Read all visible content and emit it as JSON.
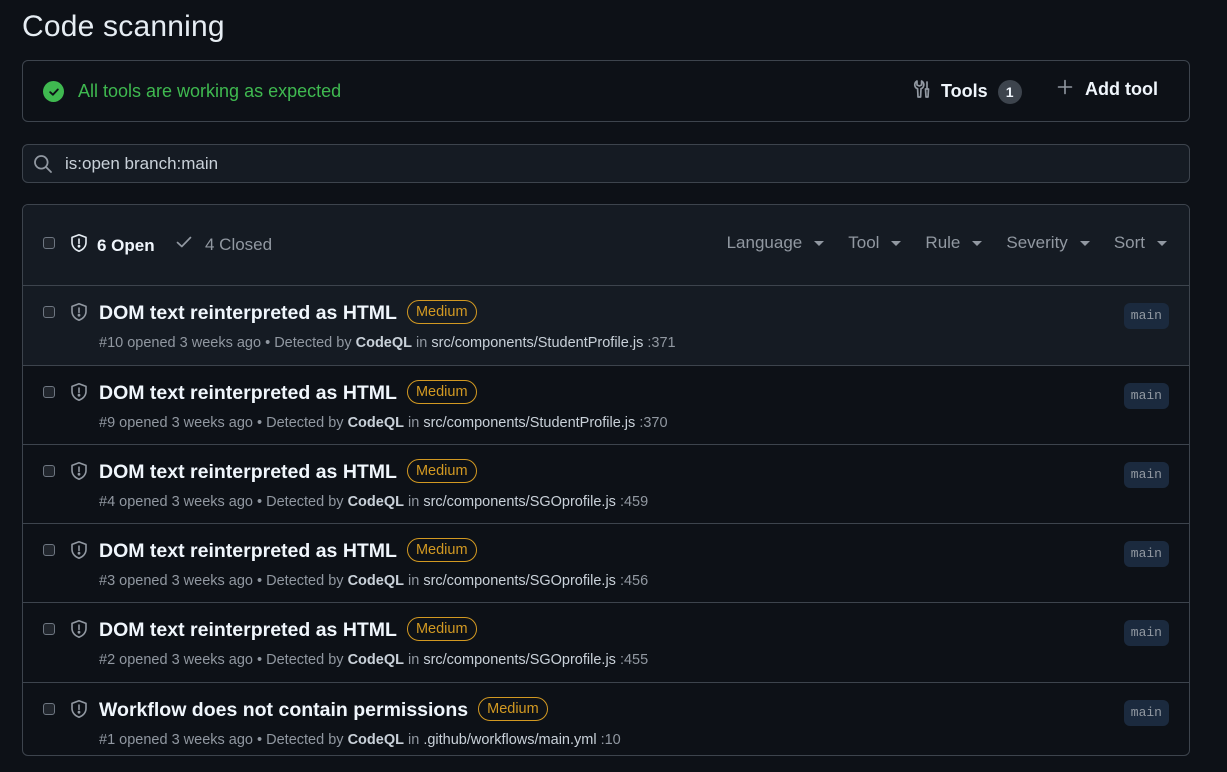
{
  "page": {
    "title": "Code scanning"
  },
  "status": {
    "message": "All tools are working as expected",
    "tools_label": "Tools",
    "tools_count": "1",
    "add_tool_label": "Add tool"
  },
  "search": {
    "value": "is:open branch:main",
    "placeholder": ""
  },
  "header": {
    "open_label": "6 Open",
    "closed_label": "4 Closed",
    "filters": [
      "Language",
      "Tool",
      "Rule",
      "Severity",
      "Sort"
    ]
  },
  "alerts": [
    {
      "title": "DOM text reinterpreted as HTML",
      "severity": "Medium",
      "number_opened": "#10 opened 3 weeks ago",
      "detected_by": "Detected by",
      "tool": "CodeQL",
      "in": "in",
      "path": "src/components/StudentProfile.js",
      "line": ":371",
      "branch": "main"
    },
    {
      "title": "DOM text reinterpreted as HTML",
      "severity": "Medium",
      "number_opened": "#9 opened 3 weeks ago",
      "detected_by": "Detected by",
      "tool": "CodeQL",
      "in": "in",
      "path": "src/components/StudentProfile.js",
      "line": ":370",
      "branch": "main"
    },
    {
      "title": "DOM text reinterpreted as HTML",
      "severity": "Medium",
      "number_opened": "#4 opened 3 weeks ago",
      "detected_by": "Detected by",
      "tool": "CodeQL",
      "in": "in",
      "path": "src/components/SGOprofile.js",
      "line": ":459",
      "branch": "main"
    },
    {
      "title": "DOM text reinterpreted as HTML",
      "severity": "Medium",
      "number_opened": "#3 opened 3 weeks ago",
      "detected_by": "Detected by",
      "tool": "CodeQL",
      "in": "in",
      "path": "src/components/SGOprofile.js",
      "line": ":456",
      "branch": "main"
    },
    {
      "title": "DOM text reinterpreted as HTML",
      "severity": "Medium",
      "number_opened": "#2 opened 3 weeks ago",
      "detected_by": "Detected by",
      "tool": "CodeQL",
      "in": "in",
      "path": "src/components/SGOprofile.js",
      "line": ":455",
      "branch": "main"
    },
    {
      "title": "Workflow does not contain permissions",
      "severity": "Medium",
      "number_opened": "#1 opened 3 weeks ago",
      "detected_by": "Detected by",
      "tool": "CodeQL",
      "in": "in",
      "path": ".github/workflows/main.yml",
      "line": ":10",
      "branch": "main"
    }
  ],
  "colors": {
    "background": "#0d1117",
    "success": "#3fb950",
    "severity_medium": "#d29922",
    "border": "#3d444d"
  },
  "icons": {
    "status": "check-circle-icon",
    "tools": "tools-icon",
    "add": "plus-icon",
    "search": "search-icon",
    "open": "shield-icon",
    "closed": "check-icon",
    "filter": "triangle-down-icon"
  }
}
